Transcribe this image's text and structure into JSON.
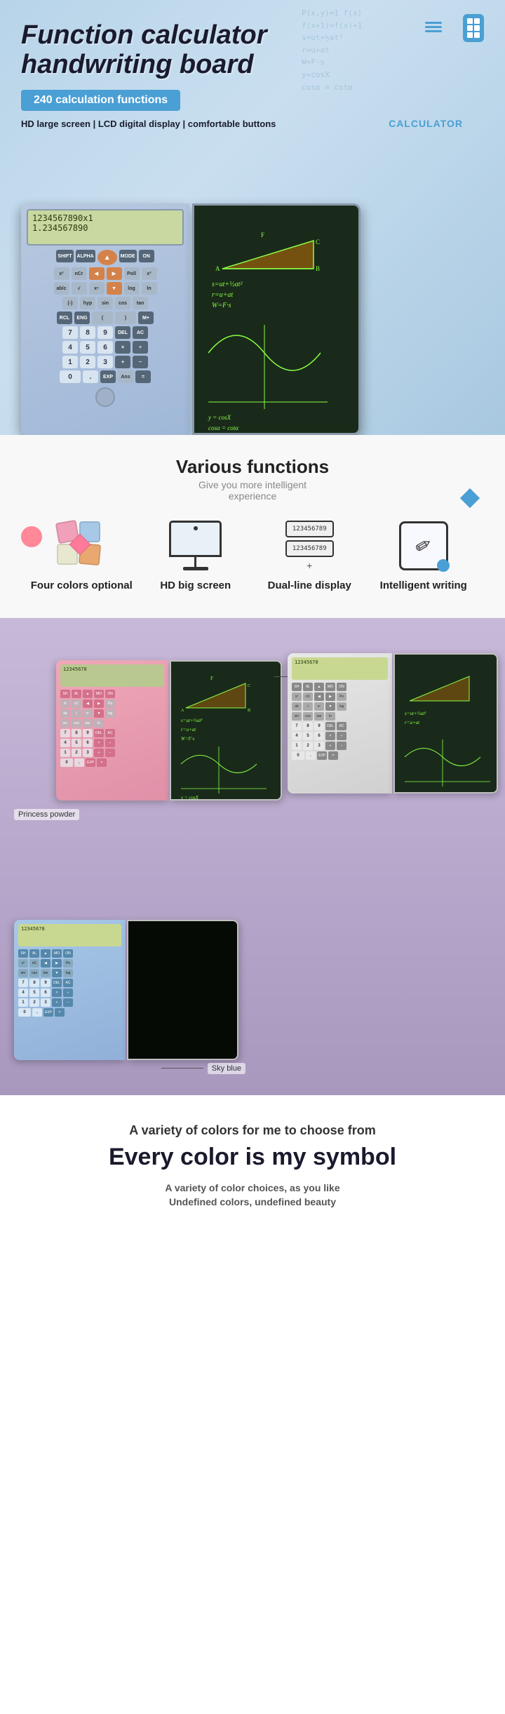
{
  "hero": {
    "title": "Function calculator handwriting board",
    "badge": "240 calculation functions",
    "features_line": "HD large screen | LCD digital display | comfortable buttons",
    "calculator_label": "CALCULATOR",
    "screen_line1": "1234567890x1",
    "screen_line2": "1.234567890",
    "math_bg": "P(x,y)=1 F(x)\nf(x+1)=f(x)+1\ns=ut+½at²\nr=u+at\nW=F·s\ny=cosX\ncosα=cotα"
  },
  "features": {
    "title": "Various functions",
    "subtitle_line1": "Give you more intelligent",
    "subtitle_line2": "experience",
    "items": [
      {
        "id": "four-colors",
        "label": "Four colors optional",
        "icon_type": "four-colors"
      },
      {
        "id": "hd-screen",
        "label": "HD big screen",
        "icon_type": "monitor"
      },
      {
        "id": "dual-display",
        "label": "Dual-line display",
        "icon_type": "dual-display",
        "display_line1": "123456789",
        "display_line2": "123456789"
      },
      {
        "id": "intelligent-writing",
        "label": "Intelligent writing",
        "icon_type": "writing"
      }
    ]
  },
  "colors_section": {
    "pink_label": "Princess powder",
    "pink_label2": "Princess powder",
    "blue_label": "Sky blue",
    "calc_screen_text": "12345678",
    "writing_lines": [
      "s=ut+½at²",
      "r=u+at",
      "W=F·s",
      "y=cosX"
    ]
  },
  "branding": {
    "subtitle": "A variety of colors for me to choose from",
    "title": "Every color is my symbol",
    "desc1": "A variety of color choices, as you like",
    "desc2": "Undefined colors, undefined beauty"
  },
  "colors": {
    "accent_blue": "#4a9fd4",
    "accent_pink": "#e090a8",
    "accent_light_blue": "#a8c8e8",
    "text_dark": "#1a1a2e",
    "green_display": "#88ff44"
  }
}
